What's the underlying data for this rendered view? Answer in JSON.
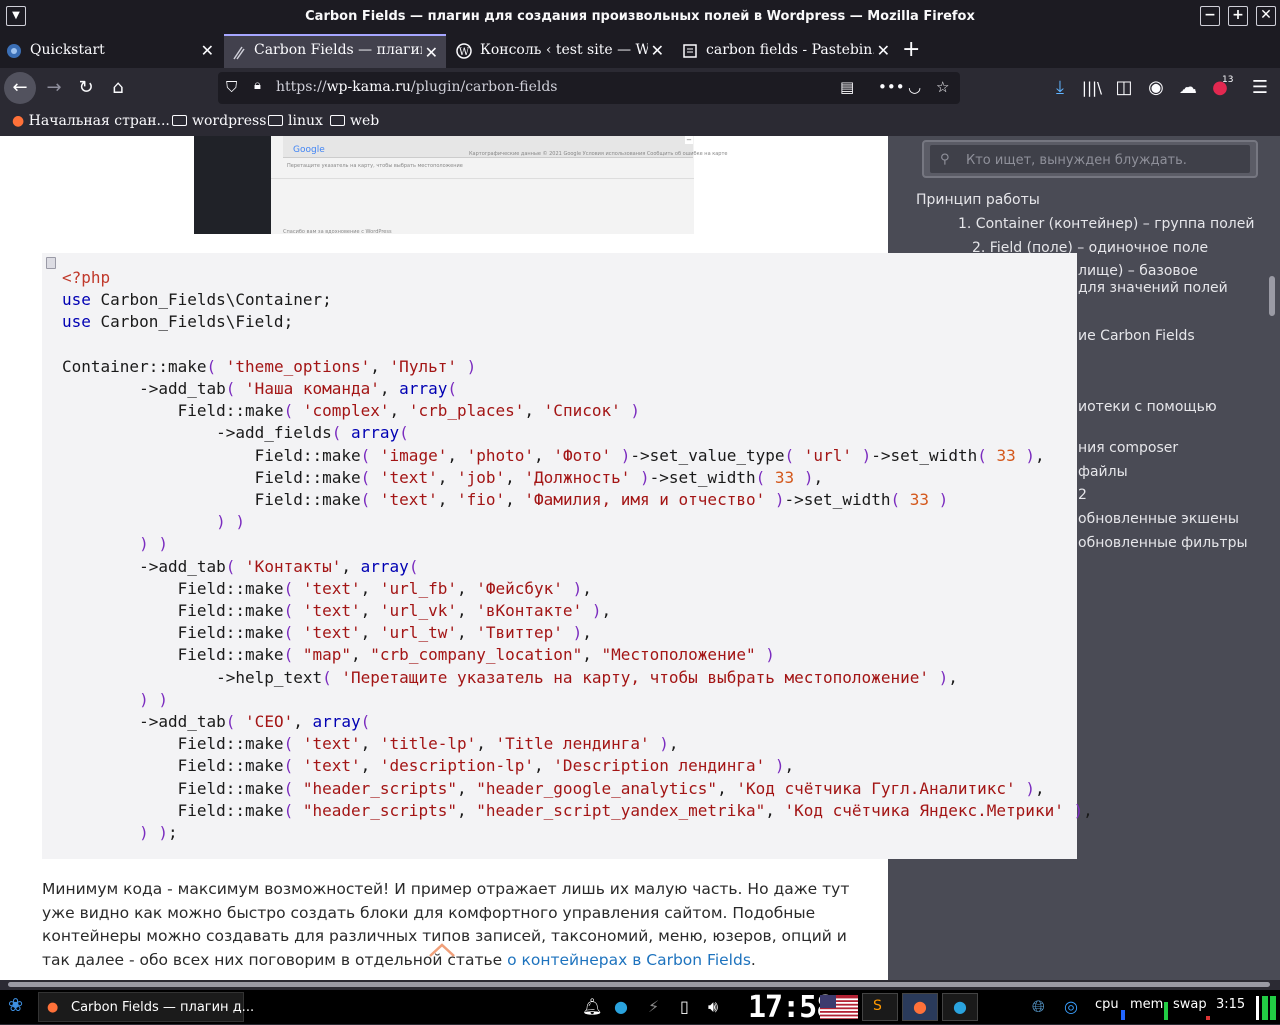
{
  "window": {
    "title": "Carbon Fields — плагин для создания произвольных полей в Wordpress — Mozilla Firefox"
  },
  "tabs": [
    {
      "label": "Quickstart",
      "icon": "quickstart-icon"
    },
    {
      "label": "Carbon Fields — плагин д",
      "icon": "carbon-fields-icon",
      "active": true
    },
    {
      "label": "Консоль ‹ test site — Word",
      "icon": "wordpress-icon"
    },
    {
      "label": "carbon fields - Pastebin.co",
      "icon": "pastebin-icon"
    }
  ],
  "nav": {
    "url_prefix": "https://",
    "url_domain": "wp-kama.ru",
    "url_path": "/plugin/carbon-fields",
    "notification_count": "13"
  },
  "bookmarks": [
    {
      "label": "Начальная стран...",
      "icon": "firefox-icon"
    },
    {
      "label": "wordpress",
      "icon": "folder-icon"
    },
    {
      "label": "linux",
      "icon": "folder-icon"
    },
    {
      "label": "web",
      "icon": "folder-icon"
    }
  ],
  "embedded_screenshot": {
    "google_label": "Google",
    "map_caption": "Перетащите указатель на карту, чтобы выбрать местоположение",
    "footer": "Спасибо вам за вдохновение с WordPress",
    "map_footer": "Картографические данные © 2021 Google   Условия использования   Сообщить об ошибке на карте"
  },
  "sidebar": {
    "search_placeholder": "Кто ищет, вынужден блуждать.",
    "toc_title": "Принцип работы",
    "toc": [
      "1. Container (контейнер) – группа полей",
      "2. Field (поле) – одиночное поле",
      "лище) – базовое",
      "для значений полей",
      "ие Carbon Fields",
      "иотеки с помощью",
      "ния composer",
      "файлы",
      "2",
      "обновленные экшены",
      "обновленные фильтры"
    ]
  },
  "code": {
    "lines": [
      "<?php",
      "use Carbon_Fields\\Container;",
      "use Carbon_Fields\\Field;",
      "",
      "Container::make( 'theme_options', 'Пульт' )",
      "        ->add_tab( 'Наша команда', array(",
      "            Field::make( 'complex', 'crb_places', 'Список' )",
      "                ->add_fields( array(",
      "                    Field::make( 'image', 'photo', 'Фото' )->set_value_type( 'url' )->set_width( 33 ),",
      "                    Field::make( 'text', 'job', 'Должность' )->set_width( 33 ),",
      "                    Field::make( 'text', 'fio', 'Фамилия, имя и отчество' )->set_width( 33 )",
      "                ) )",
      "        ) )",
      "        ->add_tab( 'Контакты', array(",
      "            Field::make( 'text', 'url_fb', 'Фейсбук' ),",
      "            Field::make( 'text', 'url_vk', 'вКонтакте' ),",
      "            Field::make( 'text', 'url_tw', 'Твиттер' ),",
      "            Field::make( \"map\", \"crb_company_location\", \"Местоположение\" )",
      "                ->help_text( 'Перетащите указатель на карту, чтобы выбрать местоположение' ),",
      "        ) )",
      "        ->add_tab( 'СЕО', array(",
      "            Field::make( 'text', 'title-lp', 'Title лендинга' ),",
      "            Field::make( 'text', 'description-lp', 'Description лендинга' ),",
      "            Field::make( \"header_scripts\", \"header_google_analytics\", 'Код счётчика Гугл.Аналитикс' ),",
      "            Field::make( \"header_scripts\", \"header_script_yandex_metrika\", 'Код счётчика Яндекс.Метрики' ),",
      "        ) );"
    ]
  },
  "paragraph": {
    "text": "Минимум кода - максимум возможностей! И пример отражает лишь их малую часть. Но даже тут уже видно как можно быстро создать блоки для комфортного управления сайтом. Подобные контейнеры можно создавать для различных типов записей, таксономий, меню, юзеров, опций и так далее - обо всех них поговорим в отдельной статье ",
    "link": "о контейнерах в Carbon Fields",
    "tail": "."
  },
  "taskbar": {
    "task_label": "Carbon Fields — плагин д...",
    "clock": "17:58",
    "cpu_label": "cpu",
    "mem_label": "mem",
    "swap_label": "swap",
    "time": "3:15"
  }
}
